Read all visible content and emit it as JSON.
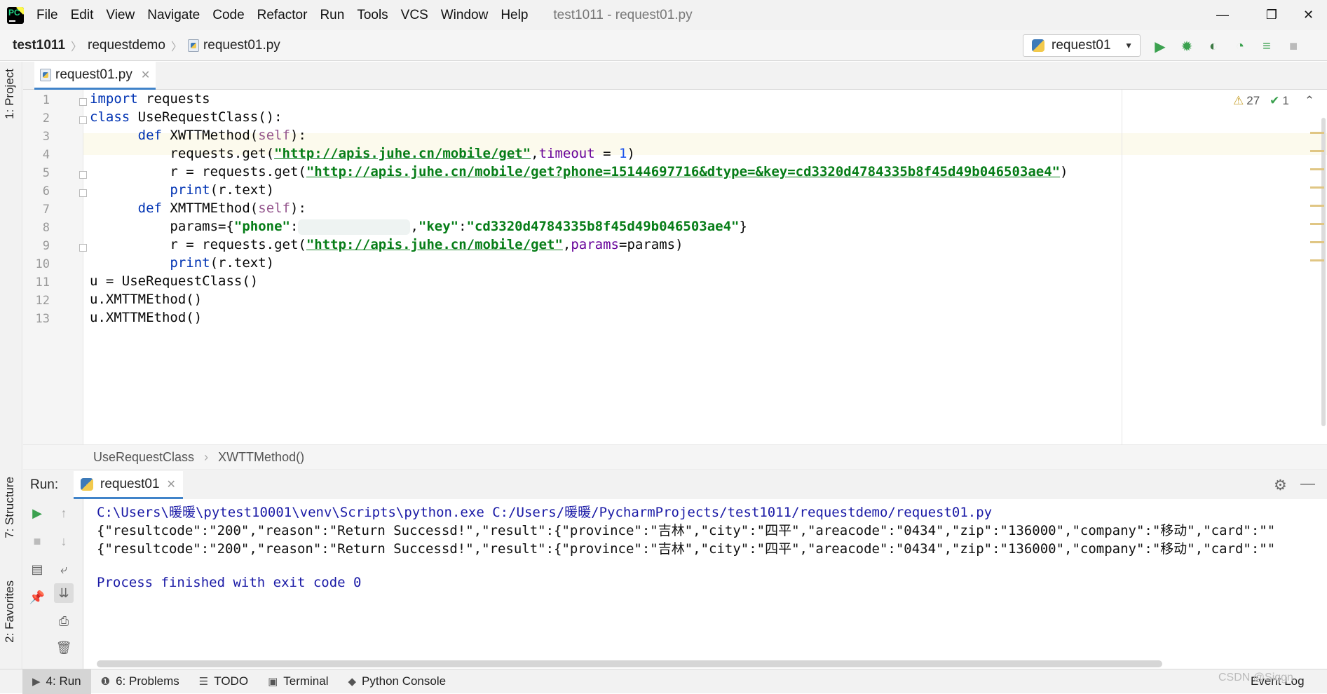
{
  "app": {
    "menu": [
      "File",
      "Edit",
      "View",
      "Navigate",
      "Code",
      "Refactor",
      "Run",
      "Tools",
      "VCS",
      "Window",
      "Help"
    ],
    "window_title": "test1011 - request01.py",
    "minimize": "—",
    "maximize": "❐",
    "close": "✕"
  },
  "navbar": {
    "project": "test1011",
    "folder": "requestdemo",
    "file": "request01.py",
    "run_config": "request01"
  },
  "side_tabs": {
    "project": "1: Project",
    "structure": "7: Structure",
    "favorites": "2: Favorites"
  },
  "editor": {
    "tab_label": "request01.py",
    "tab_close": "✕",
    "line_numbers": [
      "1",
      "2",
      "3",
      "4",
      "5",
      "6",
      "7",
      "8",
      "9",
      "10",
      "11",
      "12",
      "13"
    ],
    "inspection_warnings": "27",
    "inspection_ok": "1",
    "code": {
      "l1_kw": "import",
      "l1_rest": " requests",
      "l2_kw": "class",
      "l2_rest": " UseRequestClass():",
      "l3_kw": "def",
      "l3_name": " XWTTMethod(",
      "l3_self": "self",
      "l3_end": "):",
      "l4_a": "requests.get(",
      "l4_url": "\"http://apis.juhe.cn/mobile/get\"",
      "l4_b": ",",
      "l4_param": "timeout",
      "l4_c": " = ",
      "l4_num": "1",
      "l4_d": ")",
      "l5_a": "r = requests.get(",
      "l5_url": "\"http://apis.juhe.cn/mobile/get?phone=15144697716&dtype=&key=cd3320d4784335b8f45d49b046503ae4\"",
      "l5_b": ")",
      "l6_a": "print",
      "l6_b": "(r.text)",
      "l7_kw": "def",
      "l7_name": " XMTTMEthod(",
      "l7_self": "self",
      "l7_end": "):",
      "l8_a": "params={",
      "l8_k1": "\"phone\"",
      "l8_b": ":",
      "l8_c": ",",
      "l8_k2": "\"key\"",
      "l8_d": ":",
      "l8_v2": "\"cd3320d4784335b8f45d49b046503ae4\"",
      "l8_e": "}",
      "l9_a": "r = requests.get(",
      "l9_url": "\"http://apis.juhe.cn/mobile/get\"",
      "l9_b": ",",
      "l9_param": "params",
      "l9_c": "=params)",
      "l10_a": "print",
      "l10_b": "(r.text)",
      "l11": "u = UseRequestClass()",
      "l12": "u.XMTTMEthod()",
      "l13": "u.XMTTMEthod()"
    },
    "breadcrumb": [
      "UseRequestClass",
      "XWTTMethod()"
    ]
  },
  "run_panel": {
    "label": "Run:",
    "tab": "request01",
    "tab_close": "✕",
    "output": [
      "C:\\Users\\暖暖\\pytest10001\\venv\\Scripts\\python.exe C:/Users/暖暖/PycharmProjects/test1011/requestdemo/request01.py",
      "{\"resultcode\":\"200\",\"reason\":\"Return Successd!\",\"result\":{\"province\":\"吉林\",\"city\":\"四平\",\"areacode\":\"0434\",\"zip\":\"136000\",\"company\":\"移动\",\"card\":\"\"",
      "{\"resultcode\":\"200\",\"reason\":\"Return Successd!\",\"result\":{\"province\":\"吉林\",\"city\":\"四平\",\"areacode\":\"0434\",\"zip\":\"136000\",\"company\":\"移动\",\"card\":\"\"",
      "Process finished with exit code 0"
    ]
  },
  "bottom_tabs": [
    {
      "icon": "▶",
      "label": "4: Run"
    },
    {
      "icon": "❶",
      "label": "6: Problems"
    },
    {
      "icon": "☰",
      "label": "TODO"
    },
    {
      "icon": "▣",
      "label": "Terminal"
    },
    {
      "icon": "◆",
      "label": "Python Console"
    }
  ],
  "event_log": "Event Log",
  "watermark": "CSDN @Siqgn"
}
